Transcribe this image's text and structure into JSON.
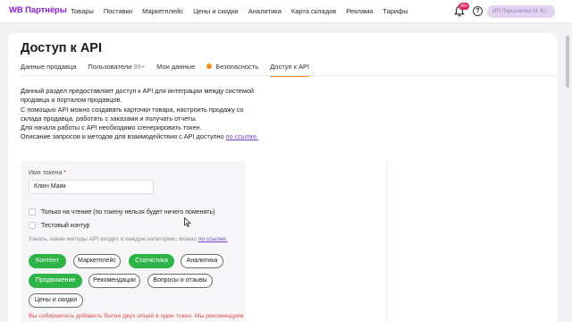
{
  "header": {
    "logo": "WB Партнёры",
    "nav": [
      "Товары",
      "Поставки",
      "Маркетплейс",
      "Цены и скидки",
      "Аналитика",
      "Карта складов",
      "Реклама",
      "Тарифы"
    ],
    "notifications_badge": "99+",
    "help": "?",
    "account": "ИП Парсенкова М. Ю."
  },
  "page": {
    "title": "Доступ к API",
    "tabs": [
      {
        "label": "Данные продавца"
      },
      {
        "label": "Пользователи",
        "count": "99+"
      },
      {
        "label": "Мои данные"
      },
      {
        "label": "Безопасность"
      },
      {
        "label": "Доступ к API"
      }
    ],
    "description": {
      "line1": "Данный раздел предоставляет доступ к API для интеграции между системой продавца и порталом продавцов.",
      "line2": "С помощью API можно создавать карточки товара, настроить продажу со склада продавца, работать с заказами и получать отчеты.",
      "line3": "Для начала работы с API необходимо сгенерировать токен.",
      "line4_text": "Описание запросов и методов для взаимодействия с API доступно",
      "line4_link": "по ссылке."
    }
  },
  "form": {
    "token_label": "Имя токена",
    "required_mark": "*",
    "token_value": "Ключ Маяк",
    "readonly_label": "Только на чтение (по токену нельзя будет ничего поменять)",
    "test_label": "Тестовый контур",
    "hint_text": "Узнать, какие методы API входят в каждую категорию, можно",
    "hint_link": "по ссылке.",
    "chips": [
      {
        "label": "Контент",
        "selected": true
      },
      {
        "label": "Маркетплейс",
        "selected": false
      },
      {
        "label": "Статистика",
        "selected": true
      },
      {
        "label": "Аналитика",
        "selected": false
      },
      {
        "label": "Продвижение",
        "selected": true
      },
      {
        "label": "Рекомендации",
        "selected": false
      },
      {
        "label": "Вопросы и отзывы",
        "selected": false
      },
      {
        "label": "Цены и скидки",
        "selected": false
      }
    ],
    "warning": "Вы собираетесь добавить более двух опций в один токен. Мы рекомендуем"
  },
  "colors": {
    "brand": "#8b1fd1",
    "accent_tab": "#f28c28",
    "chip_selected": "#2fb44a",
    "warning": "#e24b4b"
  }
}
